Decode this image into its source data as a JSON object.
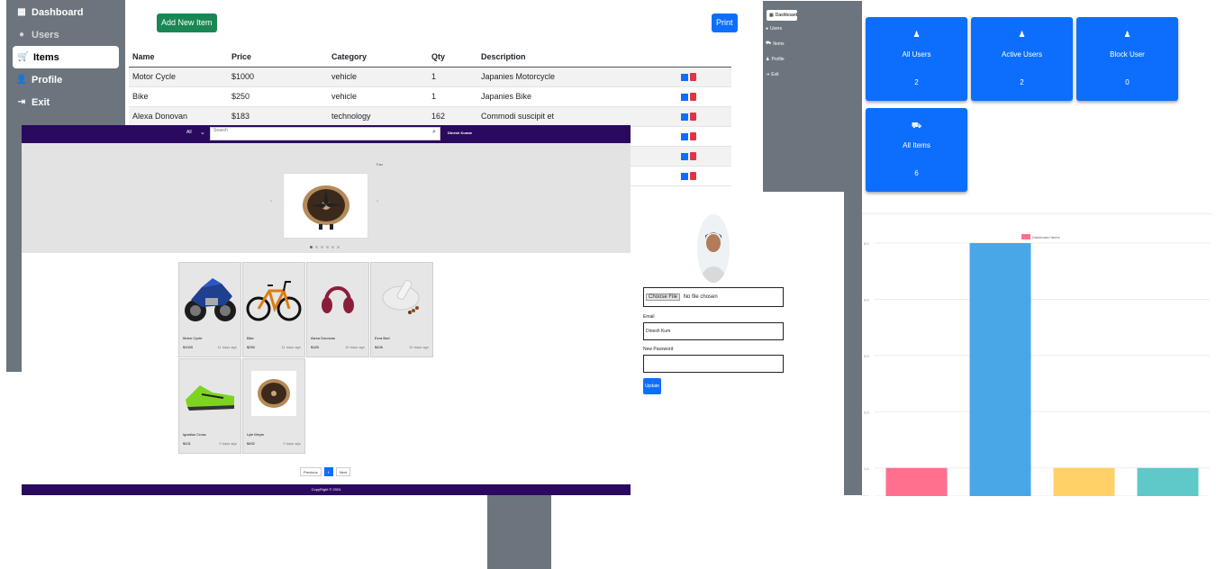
{
  "admin": {
    "sidebar": [
      {
        "label": "Dashboard",
        "icon": "grid-icon"
      },
      {
        "label": "Users",
        "icon": "users-icon"
      },
      {
        "label": "Items",
        "icon": "cart-icon"
      },
      {
        "label": "Profile",
        "icon": "user-icon"
      },
      {
        "label": "Exit",
        "icon": "exit-icon"
      }
    ],
    "add_button": "Add New Item",
    "print_button": "Print",
    "table": {
      "headers": [
        "Name",
        "Price",
        "Category",
        "Qty",
        "Description"
      ],
      "rows": [
        [
          "Motor Cycle",
          "$1000",
          "vehicle",
          "1",
          "Japanies Motorcycle"
        ],
        [
          "Bike",
          "$250",
          "vehicle",
          "1",
          "Japanies Bike"
        ],
        [
          "Alexa Donovan",
          "$183",
          "technology",
          "162",
          "Commodi suscipit et"
        ],
        [
          "",
          "",
          "",
          "",
          ""
        ],
        [
          "",
          "",
          "",
          "",
          ""
        ],
        [
          "",
          "",
          "",
          "",
          ""
        ]
      ]
    },
    "colors": {
      "add": "#198754",
      "print": "#0d6efd",
      "sidebar": "#6c757d",
      "delete": "#dc3545"
    }
  },
  "store": {
    "nav": {
      "category": "All",
      "search_placeholder": "Search",
      "user": "Dinesh Kumar"
    },
    "carousel_caption": "Fan",
    "products": [
      {
        "name": "Motor Cycle",
        "price": "$1000",
        "ago": "11 days ago",
        "icon": "motorcycle-icon"
      },
      {
        "name": "Bike",
        "price": "$250",
        "ago": "11 days ago",
        "icon": "bicycle-icon"
      },
      {
        "name": "Alexa Donovan",
        "price": "$183",
        "ago": "10 days ago",
        "icon": "headphones-icon"
      },
      {
        "name": "Ezra Burt",
        "price": "$426",
        "ago": "10 days ago",
        "icon": "mortar-icon"
      },
      {
        "name": "Ignatius Cross",
        "price": "$431",
        "ago": "9 days ago",
        "icon": "shoe-icon"
      },
      {
        "name": "Lyle Meyer",
        "price": "$492",
        "ago": "9 days ago",
        "icon": "fan-icon"
      }
    ],
    "pager": {
      "prev": "Previous",
      "page": "1",
      "next": "Next"
    },
    "footer": "CopyRight © 2024",
    "colors": {
      "navbar": "#2a0a5e"
    }
  },
  "profile": {
    "file_button": "Choose File",
    "file_name": "No file chosen",
    "email_label": "Email",
    "email_value": "Dinesh Kum",
    "password_label": "New Password",
    "update_button": "Update"
  },
  "dashboard": {
    "sidebar": [
      {
        "label": "Dashboard",
        "icon": "grid-icon"
      },
      {
        "label": "Users",
        "icon": "users-icon"
      },
      {
        "label": "Items",
        "icon": "cart-icon"
      },
      {
        "label": "Profile",
        "icon": "user-icon"
      },
      {
        "label": "Exit",
        "icon": "exit-icon"
      }
    ],
    "cards": [
      {
        "label": "All Users",
        "value": "2",
        "icon": "user-icon"
      },
      {
        "label": "Active Users",
        "value": "2",
        "icon": "user-check-icon"
      },
      {
        "label": "Block User",
        "value": "0",
        "icon": "user-block-icon"
      },
      {
        "label": "All Items",
        "value": "6",
        "icon": "cart-icon"
      }
    ]
  },
  "chart_data": {
    "type": "bar",
    "legend": "top-center",
    "series_label": "Dashboard Items",
    "categories": [
      "",
      "",
      "",
      ""
    ],
    "values": [
      1,
      5,
      1,
      1
    ],
    "colors": [
      "#ff6f8e",
      "#49a7e8",
      "#ffd166",
      "#5fc8c8"
    ],
    "ylim": [
      0.5,
      5
    ],
    "yticks": [
      "5.0",
      "4.0",
      "3.0",
      "2.0",
      "1.0",
      "0.5"
    ],
    "grid": true
  }
}
